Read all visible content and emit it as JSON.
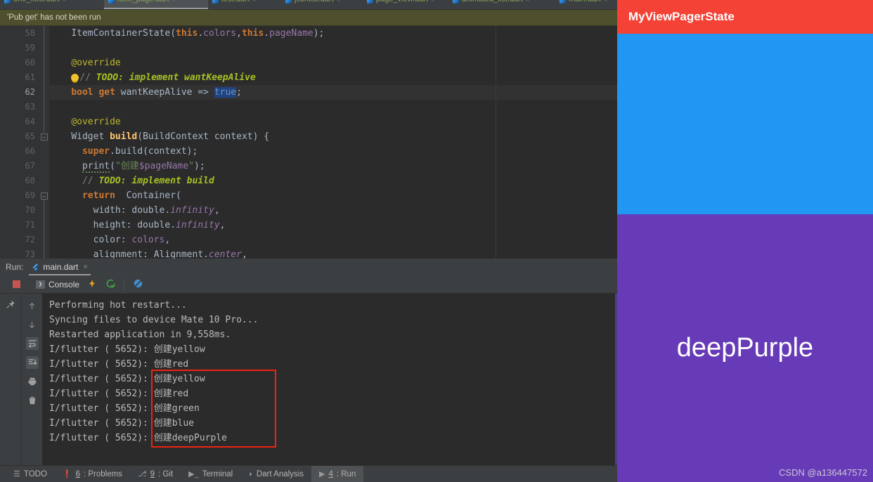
{
  "editor_tabs": [
    {
      "label": "one_flow.dart",
      "active": false
    },
    {
      "label": "item_page.dart",
      "active": true
    },
    {
      "label": "test.dart",
      "active": false
    },
    {
      "label": "jsonlist.dart",
      "active": false
    },
    {
      "label": "page_view.dart",
      "active": false
    },
    {
      "label": "animated_list.dart",
      "active": false
    },
    {
      "label": "main.dart",
      "active": false
    }
  ],
  "banner": {
    "message": "'Pub get' has not been run"
  },
  "code": {
    "lines": [
      {
        "n": "58",
        "marker": "none",
        "text": "    ItemContainerState(this.colors,this.pageName);"
      },
      {
        "n": "59",
        "marker": "none",
        "text": ""
      },
      {
        "n": "60",
        "marker": "none",
        "text": "    @override"
      },
      {
        "n": "61",
        "marker": "none",
        "text": "    // TODO: implement wantKeepAlive"
      },
      {
        "n": "62",
        "marker": "override",
        "text": "    bool get wantKeepAlive => true;"
      },
      {
        "n": "63",
        "marker": "none",
        "text": ""
      },
      {
        "n": "64",
        "marker": "none",
        "text": "    @override"
      },
      {
        "n": "65",
        "marker": "override",
        "text": "    Widget build(BuildContext context) {"
      },
      {
        "n": "66",
        "marker": "none",
        "text": "      super.build(context);"
      },
      {
        "n": "67",
        "marker": "none",
        "text": "      print(\"创建$pageName\");"
      },
      {
        "n": "68",
        "marker": "none",
        "text": "      // TODO: implement build"
      },
      {
        "n": "69",
        "marker": "none",
        "text": "      return  Container("
      },
      {
        "n": "70",
        "marker": "none",
        "text": "        width: double.infinity,"
      },
      {
        "n": "71",
        "marker": "none",
        "text": "        height: double.infinity,"
      },
      {
        "n": "72",
        "marker": "none",
        "text": "        color: colors,"
      },
      {
        "n": "73",
        "marker": "none",
        "text": "        alignment: Alignment.center,"
      }
    ],
    "selected_token": "true"
  },
  "run_panel": {
    "label": "Run:",
    "tab_label": "main.dart",
    "tab_close": "×",
    "console_button": "Console",
    "console_icon_glyph": "❯",
    "stop_tooltip": "Stop",
    "toolbar_icons": [
      "lightning-icon",
      "hot-restart-icon",
      "flutter-inspector-icon"
    ],
    "gutter_icons": [
      "pin-icon",
      "arrow-up-icon",
      "arrow-down-icon",
      "soft-wrap-icon",
      "scroll-to-end-icon",
      "print-icon",
      "trash-icon"
    ],
    "output": [
      {
        "text": "Performing hot restart...",
        "boxed": false
      },
      {
        "text": "Syncing files to device Mate 10 Pro...",
        "boxed": false
      },
      {
        "text": "Restarted application in 9,558ms.",
        "boxed": false
      },
      {
        "text": "I/flutter ( 5652): 创建yellow",
        "boxed": false
      },
      {
        "text": "I/flutter ( 5652): 创建red",
        "boxed": false
      },
      {
        "text": "I/flutter ( 5652): 创建yellow",
        "boxed": true
      },
      {
        "text": "I/flutter ( 5652): 创建red",
        "boxed": true
      },
      {
        "text": "I/flutter ( 5652): 创建green",
        "boxed": true
      },
      {
        "text": "I/flutter ( 5652): 创建blue",
        "boxed": true
      },
      {
        "text": "I/flutter ( 5652): 创建deepPurple",
        "boxed": true
      }
    ],
    "highlight_color": "#ee2211"
  },
  "status_bar": {
    "items": [
      {
        "icon": "list-icon",
        "glyph": "☰",
        "num": "",
        "label": "TODO",
        "active": false
      },
      {
        "icon": "error-icon",
        "glyph": "❗",
        "num": "6",
        "label": ": Problems",
        "active": false
      },
      {
        "icon": "git-branch-icon",
        "glyph": "⎇",
        "num": "9",
        "label": ": Git",
        "active": false
      },
      {
        "icon": "terminal-icon",
        "glyph": "▶_",
        "num": "",
        "label": "Terminal",
        "active": false
      },
      {
        "icon": "dart-icon",
        "glyph": "◗",
        "num": "",
        "label": "Dart Analysis",
        "active": false
      },
      {
        "icon": "run-icon",
        "glyph": "▶",
        "num": "4",
        "label": ": Run",
        "active": true
      }
    ]
  },
  "phone": {
    "appbar_title": "MyViewPagerState",
    "appbar_color": "#f44336",
    "page_blue_color": "#2196f3",
    "page_purple_color": "#673ab7",
    "page_label": "deepPurple",
    "watermark": "CSDN @a136447572"
  }
}
